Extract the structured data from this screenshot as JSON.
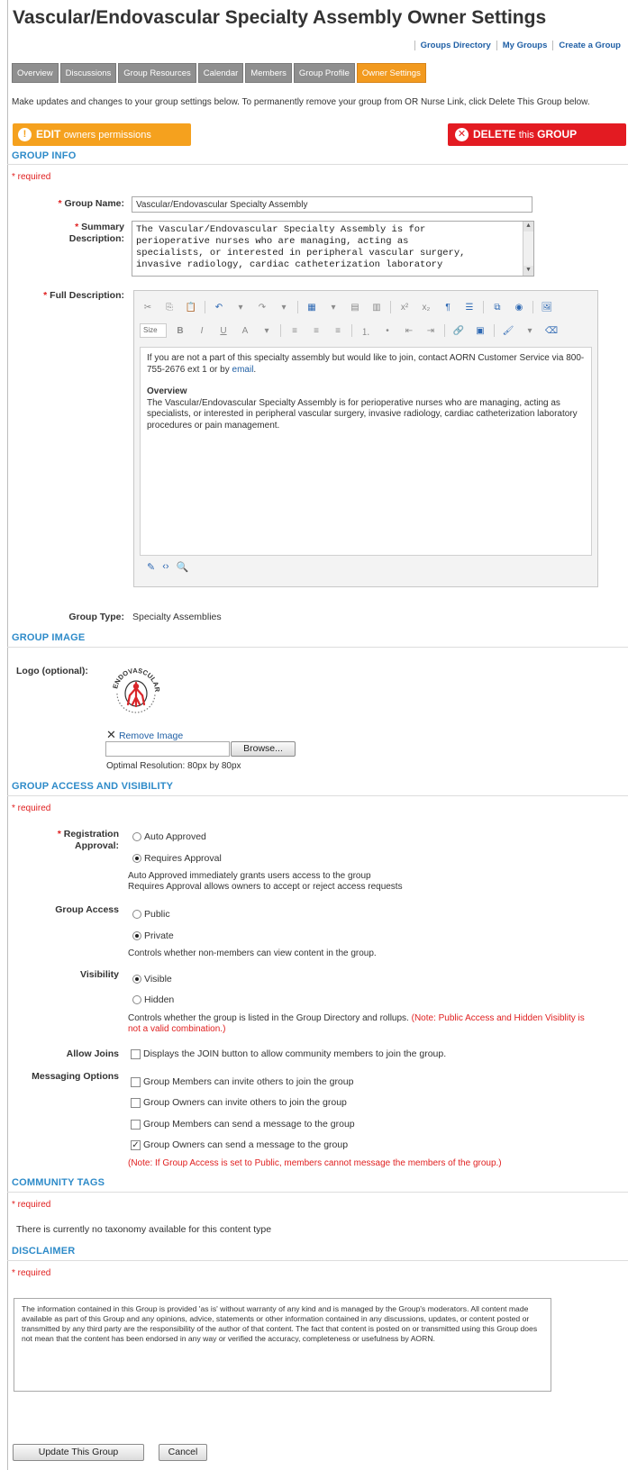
{
  "header": {
    "title": "Vascular/Endovascular Specialty Assembly Owner Settings",
    "links": [
      "Groups Directory",
      "My Groups",
      "Create a Group"
    ]
  },
  "tabs": [
    {
      "label": "Overview"
    },
    {
      "label": "Discussions"
    },
    {
      "label": "Group Resources"
    },
    {
      "label": "Calendar"
    },
    {
      "label": "Members"
    },
    {
      "label": "Group Profile"
    },
    {
      "label": "Owner Settings",
      "active": true
    }
  ],
  "intro": "Make updates and changes to your group settings below. To permanently remove your group from OR Nurse Link, click Delete This Group below.",
  "buttons": {
    "edit_main": "EDIT",
    "edit_sub": "owners permissions",
    "delete_main": "DELETE",
    "delete_sub": "this",
    "delete_main2": "GROUP",
    "update": "Update This Group",
    "cancel": "Cancel",
    "browse": "Browse..."
  },
  "group_info": {
    "heading": "GROUP INFO",
    "required": "* required",
    "name_label": "Group Name:",
    "name_value": "Vascular/Endovascular Specialty Assembly",
    "summary_label_1": "Summary",
    "summary_label_2": "Description:",
    "summary_lines": [
      "The Vascular/Endovascular Specialty Assembly is for",
      "perioperative nurses who are managing, acting as",
      "specialists, or interested in peripheral vascular surgery,",
      "invasive radiology, cardiac catheterization laboratory"
    ],
    "full_label": "Full Description:",
    "size_label": "Size",
    "full_p1_a": "If you are not a part of this specialty assembly but would like to join, contact AORN Customer Service via 800-755-2676 ext 1 or by ",
    "full_p1_link": "email",
    "full_p1_b": ".",
    "full_overview_heading": "Overview",
    "full_overview_text": "The Vascular/Endovascular Specialty Assembly is for perioperative nurses who are managing, acting as specialists, or interested in peripheral vascular surgery, invasive radiology, cardiac catheterization laboratory procedures or pain management.",
    "type_label": "Group Type:",
    "type_value": "Specialty Assemblies"
  },
  "group_image": {
    "heading": "GROUP IMAGE",
    "logo_label": "Logo (optional):",
    "logo_text": "ENDOVASCULAR",
    "remove": "Remove Image",
    "optimal": "Optimal Resolution: 80px by 80px"
  },
  "access": {
    "heading": "GROUP ACCESS AND VISIBILITY",
    "required": "* required",
    "reg_label_1": "Registration",
    "reg_label_2": "Approval:",
    "reg_options": [
      "Auto Approved",
      "Requires Approval"
    ],
    "reg_selected": 1,
    "reg_note_1": "Auto Approved immediately grants users access to the group",
    "reg_note_2": "Requires Approval allows owners to accept or reject access requests",
    "access_label": "Group Access",
    "access_options": [
      "Public",
      "Private"
    ],
    "access_selected": 1,
    "access_note": "Controls whether non-members can view content in the group.",
    "vis_label": "Visibility",
    "vis_options": [
      "Visible",
      "Hidden"
    ],
    "vis_selected": 0,
    "vis_note_a": "Controls whether the group is listed in the Group Directory and rollups. ",
    "vis_note_red": "(Note: Public Access and Hidden Visiblity is not a valid combination.)",
    "joins_label": "Allow Joins",
    "joins_text": "Displays the JOIN button to allow community members to join the group.",
    "joins_checked": false,
    "msg_label": "Messaging Options",
    "msg_options": [
      {
        "label": "Group Members can invite others to join the group",
        "checked": false
      },
      {
        "label": "Group Owners can invite others to join the group",
        "checked": false
      },
      {
        "label": "Group Members can send a message to the group",
        "checked": false
      },
      {
        "label": "Group Owners can send a message to the group",
        "checked": true
      }
    ],
    "msg_note": "(Note: If Group Access is set to Public, members cannot message the members of the group.)"
  },
  "tags": {
    "heading": "COMMUNITY TAGS",
    "required": "* required",
    "text": "There is currently no taxonomy available for this content type"
  },
  "disclaimer": {
    "heading": "DISCLAIMER",
    "required": "* required",
    "text": "The information contained in this Group is provided 'as is' without warranty of any kind and is managed by the Group's moderators. All content made available as part of this Group and any opinions, advice, statements or other information contained in any discussions, updates, or content posted or transmitted by any third party are the responsibility of the author of that content. The fact that content is posted on or transmitted using this Group does not mean that the content has been endorsed in any way or verified the accuracy, completeness or usefulness by AORN."
  },
  "colors": {
    "accent_orange": "#f5a11e",
    "delete_red": "#e31b22",
    "heading_blue": "#2e8bc9",
    "link_blue": "#1f5fa5",
    "tab_gray": "#8f8f8f"
  }
}
